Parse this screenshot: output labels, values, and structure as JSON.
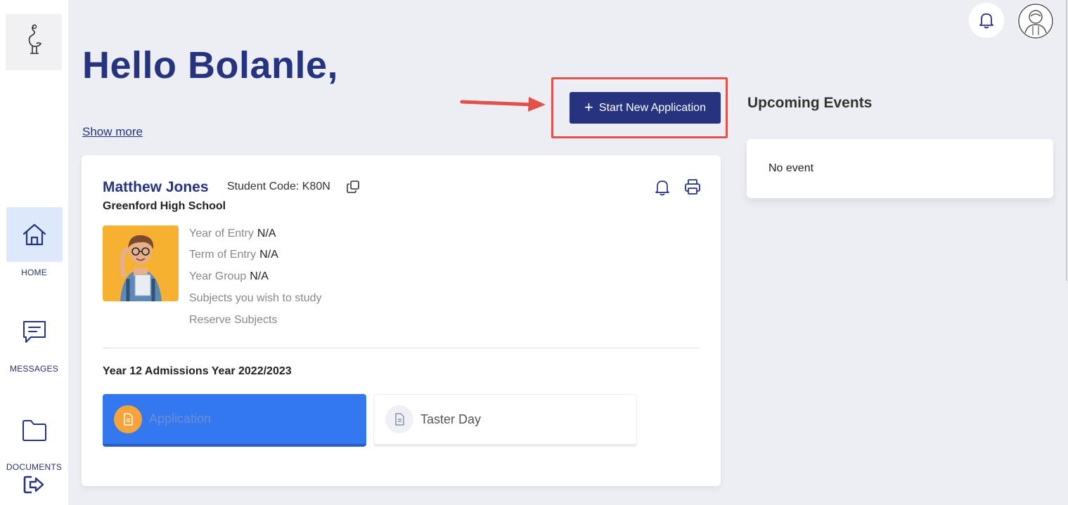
{
  "sidebar": {
    "items": [
      {
        "label": "HOME",
        "icon": "home-icon",
        "active": true
      },
      {
        "label": "MESSAGES",
        "icon": "message-icon",
        "active": false
      },
      {
        "label": "DOCUMENTS",
        "icon": "folder-icon",
        "active": false
      }
    ]
  },
  "header": {
    "greeting": "Hello Bolanle,",
    "show_more": "Show more",
    "start_button": "Start New Application",
    "start_button_icon": "+"
  },
  "events": {
    "title": "Upcoming Events",
    "empty": "No event"
  },
  "student": {
    "name": "Matthew Jones",
    "code": "Student Code: K80N",
    "school": "Greenford High School",
    "details": [
      {
        "label": "Year of Entry",
        "value": "N/A"
      },
      {
        "label": "Term of Entry",
        "value": "N/A"
      },
      {
        "label": "Year Group",
        "value": "N/A"
      },
      {
        "label": "Subjects you wish to study",
        "value": ""
      },
      {
        "label": "Reserve Subjects",
        "value": ""
      }
    ],
    "admissions_title": "Year 12 Admissions Year 2022/2023",
    "tabs": [
      {
        "label": "Application",
        "active": true
      },
      {
        "label": "Taster Day",
        "active": false
      }
    ]
  },
  "colors": {
    "brand": "#26337f",
    "accent": "#3478f0",
    "highlight": "#e0524a",
    "orange": "#f6a43a"
  }
}
